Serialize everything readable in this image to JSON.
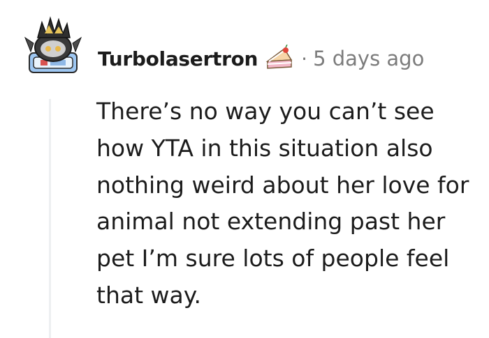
{
  "comment": {
    "author": {
      "username": "Turbolasertron",
      "avatar_icon": "snoo-avatar-icon",
      "award_icon": "cake-slice-icon"
    },
    "separator": "·",
    "timestamp": "5 days ago",
    "body": "There’s no way you can’t see how YTA in this situation also nothing weird about her love for animal not extending past her pet I’m sure lots of people feel that way."
  },
  "colors": {
    "text": "#1c1c1c",
    "meta": "#7c7c7c",
    "thread_line": "#edeff1"
  }
}
